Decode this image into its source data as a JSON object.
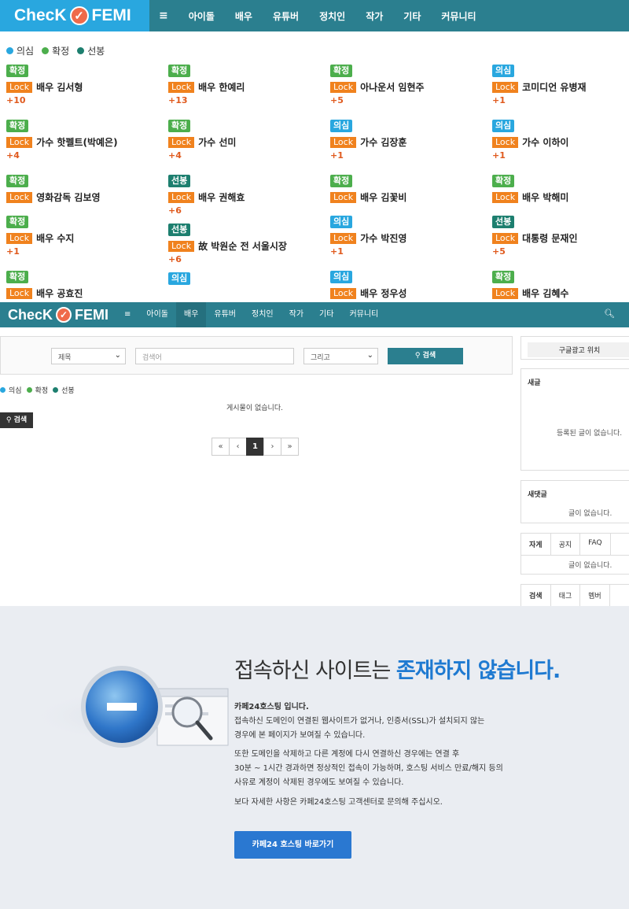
{
  "header1": {
    "logo_left": "ChecK",
    "logo_right": "FEMI",
    "nav": [
      "≡",
      "아이돌",
      "배우",
      "유튜버",
      "정치인",
      "작가",
      "기타",
      "커뮤니티"
    ]
  },
  "legend": {
    "doubt": "의심",
    "confirm": "확정",
    "first": "선봉",
    "colors": {
      "doubt": "#29a7df",
      "confirm": "#4cae4c",
      "first": "#1d7f6f"
    }
  },
  "lock_label": "Lock",
  "cards": [
    {
      "status": "확정",
      "kind": "confirm",
      "name": "배우 김서형",
      "count": "+10"
    },
    {
      "status": "확정",
      "kind": "confirm",
      "name": "배우 한예리",
      "count": "+13"
    },
    {
      "status": "확정",
      "kind": "confirm",
      "name": "아나운서 임현주",
      "count": "+5"
    },
    {
      "status": "의심",
      "kind": "doubt",
      "name": "코미디언 유병재",
      "count": "+1"
    },
    {
      "status": "확정",
      "kind": "confirm",
      "name": "가수 핫펠트(박예은)",
      "count": "+4"
    },
    {
      "status": "확정",
      "kind": "confirm",
      "name": "가수 선미",
      "count": "+4"
    },
    {
      "status": "의심",
      "kind": "doubt",
      "name": "가수 김장훈",
      "count": "+1"
    },
    {
      "status": "의심",
      "kind": "doubt",
      "name": "가수 이하이",
      "count": "+1"
    },
    {
      "status": "확정",
      "kind": "confirm",
      "name": "영화감독 김보영",
      "count": ""
    },
    {
      "status": "선봉",
      "kind": "first",
      "name": "배우 권해효",
      "count": "+6"
    },
    {
      "status": "확정",
      "kind": "confirm",
      "name": "배우 김꽃비",
      "count": ""
    },
    {
      "status": "확정",
      "kind": "confirm",
      "name": "배우 박해미",
      "count": ""
    },
    {
      "status": "확정",
      "kind": "confirm",
      "name": "배우 수지",
      "count": "+1"
    },
    {
      "status": "선봉",
      "kind": "first",
      "name": "故 박원순 전 서울시장",
      "count": "+6"
    },
    {
      "status": "의심",
      "kind": "doubt",
      "name": "가수 박진영",
      "count": "+1"
    },
    {
      "status": "선봉",
      "kind": "first",
      "name": "대통령 문재인",
      "count": "+5"
    },
    {
      "status": "확정",
      "kind": "confirm",
      "name": "배우 공효진",
      "count": ""
    },
    {
      "status": "의심",
      "kind": "doubt",
      "name": "",
      "count": ""
    },
    {
      "status": "의심",
      "kind": "doubt",
      "name": "배우 정우성",
      "count": ""
    },
    {
      "status": "확정",
      "kind": "confirm",
      "name": "배우 김혜수",
      "count": ""
    }
  ],
  "header2": {
    "logo_left": "ChecK",
    "logo_right": "FEMI",
    "nav": [
      "≡",
      "아이돌",
      "배우",
      "유튜버",
      "정치인",
      "작가",
      "기타",
      "커뮤니티"
    ]
  },
  "search": {
    "field_select": "제목",
    "placeholder": "검색어",
    "op_select": "그리고",
    "button": "검색"
  },
  "no_posts": "게시물이 없습니다.",
  "search_small": "검색",
  "pager": [
    "«",
    "‹",
    "1",
    "›",
    "»"
  ],
  "sidebar": {
    "ad": "구글광고 위치",
    "new_posts_title": "새글",
    "new_posts_msg": "등록된 글이 없습니다.",
    "new_comments_title": "새댓글",
    "new_comments_msg": "글이 없습니다.",
    "tabs1": [
      "자게",
      "공지",
      "FAQ"
    ],
    "tabs1_msg": "글이 없습니다.",
    "tabs2": [
      "검색",
      "태그",
      "멤버"
    ]
  },
  "cafe24": {
    "headline_a": "접속하신 사이트는 ",
    "headline_b": "존재하지 않습니다.",
    "p1_title": "카페24호스팅 입니다.",
    "p1_l1": "접속하신 도메인이 연결된 웹사이트가 없거나, 인증서(SSL)가 설치되지 않는",
    "p1_l2": "경우에 본 페이지가 보여질 수 있습니다.",
    "p2_l1": "또한 도메인을 삭제하고 다른 계정에 다시 연결하신 경우에는 연결 후",
    "p2_l2": "30분 ~ 1시간 경과하면 정상적인 접속이 가능하며, 호스팅 서비스 만료/해지 등의",
    "p2_l3": "사유로 계정이 삭제된 경우에도 보여질 수 있습니다.",
    "p3": "보다 자세한 사항은 카페24호스팅 고객센터로 문의해 주십시오.",
    "button": "카페24 호스팅 바로가기"
  }
}
